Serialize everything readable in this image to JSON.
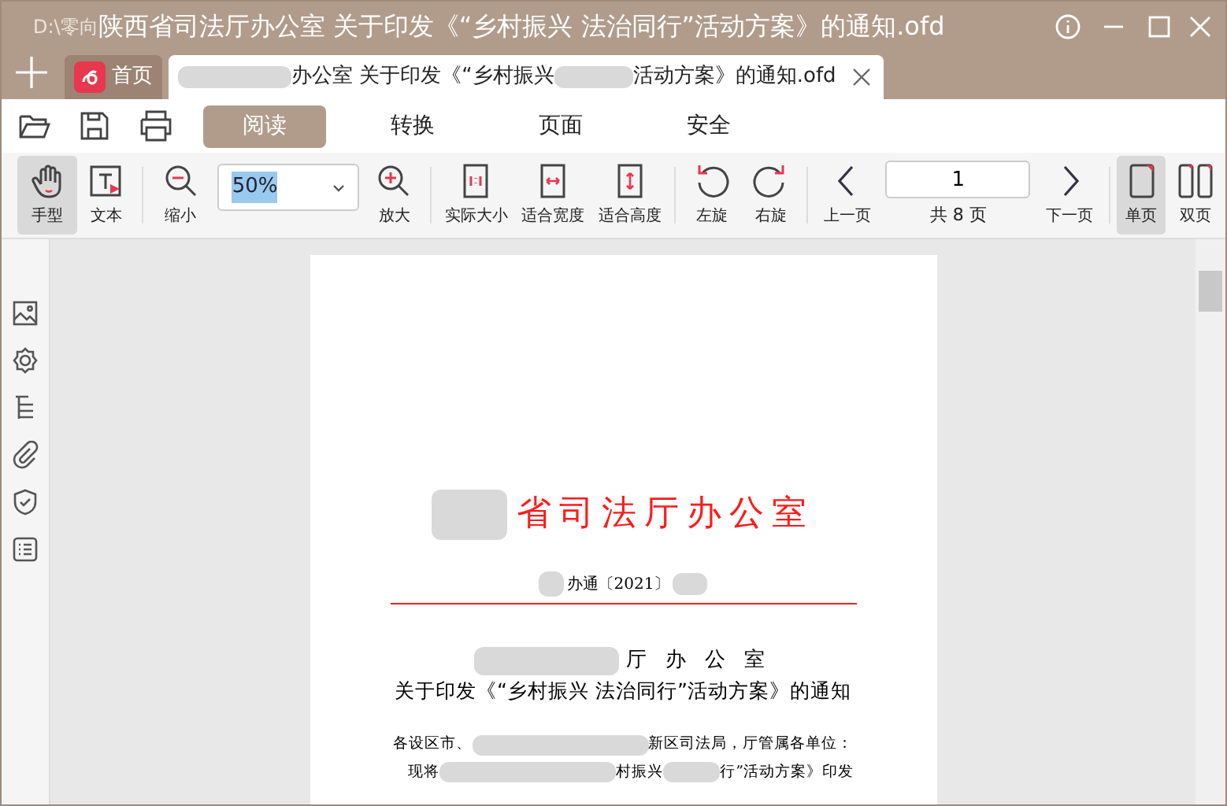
{
  "window": {
    "path": "D:\\零向",
    "title": "陕西省司法厅办公室 关于印发《“乡村振兴 法治同行”活动方案》的通知.ofd"
  },
  "tabs": [
    {
      "kind": "home",
      "label": "首页",
      "selected": false
    },
    {
      "kind": "doc",
      "parts": [
        {
          "kind": "redacted"
        },
        {
          "kind": "text",
          "text": "办公室 关于印发《“乡村振兴"
        },
        {
          "kind": "redacted"
        },
        {
          "kind": "text",
          "text": "活动方案》的通知.ofd"
        }
      ],
      "selected": true
    }
  ],
  "menu": [
    {
      "label": "阅读",
      "selected": true
    },
    {
      "label": "转换",
      "selected": false
    },
    {
      "label": "页面",
      "selected": false
    },
    {
      "label": "安全",
      "selected": false
    }
  ],
  "toolbar": [
    [
      {
        "kind": "tool",
        "label": "手型",
        "selected": true
      },
      {
        "kind": "tool",
        "label": "文本",
        "selected": false
      }
    ],
    [
      {
        "kind": "tool",
        "label": "缩小",
        "selected": false
      },
      {
        "kind": "zoom",
        "value": "50%"
      },
      {
        "kind": "tool",
        "label": "放大",
        "selected": false
      }
    ],
    [
      {
        "kind": "tool",
        "label": "实际大小",
        "selected": false
      },
      {
        "kind": "tool",
        "label": "适合宽度",
        "selected": false
      },
      {
        "kind": "tool",
        "label": "适合高度",
        "selected": false
      }
    ],
    [
      {
        "kind": "tool",
        "label": "左旋",
        "selected": false
      },
      {
        "kind": "tool",
        "label": "右旋",
        "selected": false
      }
    ],
    [
      {
        "kind": "tool",
        "label": "上一页",
        "selected": false
      },
      {
        "kind": "pager",
        "value": "1",
        "total": "共 8 页"
      },
      {
        "kind": "tool",
        "label": "下一页",
        "selected": false
      }
    ],
    [
      {
        "kind": "tool",
        "label": "单页",
        "selected": true
      },
      {
        "kind": "tool",
        "label": "双页",
        "selected": false
      }
    ]
  ],
  "document": {
    "header": "省司法厅办公室",
    "doc_number": "办通〔2021〕",
    "title_line_1": "厅 办 公 室",
    "title_line_2": "关于印发《“乡村振兴 法治同行”活动方案》的通知",
    "body": [
      [
        {
          "kind": "text",
          "text": "各设区市、"
        },
        {
          "kind": "redacted"
        },
        {
          "kind": "text",
          "text": "新区司法局，厅管属各单位："
        }
      ],
      [
        {
          "kind": "text",
          "text": "现将"
        },
        {
          "kind": "redacted"
        },
        {
          "kind": "text",
          "text": "村振兴"
        },
        {
          "kind": "redacted"
        },
        {
          "kind": "text",
          "text": "行”活动方案》印发"
        }
      ]
    ]
  }
}
